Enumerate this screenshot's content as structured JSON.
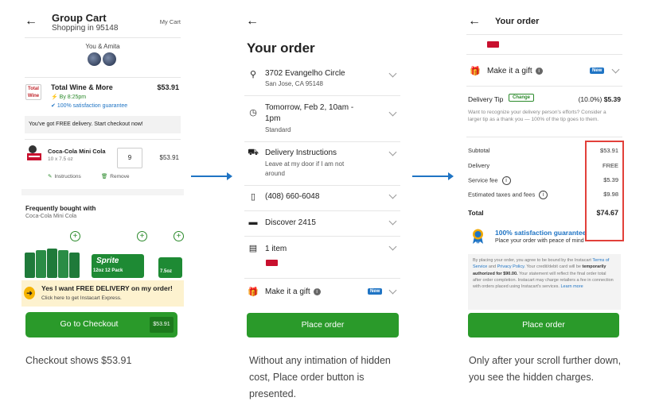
{
  "panel1": {
    "title": "Group Cart",
    "subtitle": "Shopping in 95148",
    "my_cart": "My Cart",
    "members": "You & Amita",
    "store": {
      "logo_text": "Total Wine",
      "name": "Total Wine & More",
      "price": "$53.91",
      "eta": "By 8:25pm",
      "guarantee": "100% satisfaction guarantee"
    },
    "free_delivery_notice": "You've got FREE delivery. Start checkout now!",
    "item": {
      "name": "Coca-Cola Mini Cola",
      "size": "10 x 7.5 oz",
      "quantity": "9",
      "price": "$53.91",
      "instructions_label": "Instructions",
      "remove_label": "Remove"
    },
    "frequently_bought": {
      "title": "Frequently bought with",
      "subtitle": "Coca-Cola Mini Cola",
      "pack_label_1": "12oz 12 Pack",
      "pack_label_2": "7.5oz"
    },
    "promo": {
      "title": "Yes I want FREE DELIVERY on my order!",
      "subtitle": "Click here to get Instacart Express."
    },
    "checkout_button": "Go to Checkout",
    "checkout_price": "$53.91"
  },
  "panel2": {
    "title": "Your order",
    "address": {
      "line1": "3702 Evangelho Circle",
      "line2": "San Jose, CA 95148"
    },
    "delivery_time": {
      "line1": "Tomorrow, Feb 2, 10am -",
      "line2": "1pm",
      "sub": "Standard"
    },
    "instructions": {
      "title": "Delivery Instructions",
      "line1": "Leave at my door if I am not",
      "line2": "around"
    },
    "phone": "(408) 660-6048",
    "payment": "Discover 2415",
    "items": "1 item",
    "gift": "Make it a gift",
    "new_badge": "New",
    "place_order": "Place order"
  },
  "panel3": {
    "title": "Your order",
    "gift": "Make it a gift",
    "new_badge": "New",
    "tip": {
      "label": "Delivery Tip",
      "change": "Change",
      "percent": "(10.0%)",
      "amount": "$5.39",
      "description": "Want to recognize your delivery person's efforts? Consider a larger tip as a thank you — 100% of the tip goes to them."
    },
    "summary": {
      "subtotal_label": "Subtotal",
      "subtotal": "$53.91",
      "delivery_label": "Delivery",
      "delivery": "FREE",
      "service_label": "Service fee",
      "service": "$5.39",
      "taxes_label": "Estimated taxes and fees",
      "taxes": "$9.98",
      "total_label": "Total",
      "total": "$74.67"
    },
    "guarantee_title": "100% satisfaction guarantee",
    "guarantee_sub": "Place your order with peace of mind",
    "legal": {
      "p1": "By placing your order, you agree to be bound by the Instacart",
      "terms": "Terms of Service",
      "and": "and",
      "privacy": "Privacy Policy.",
      "p2": "Your credit/debit card will be",
      "auth": "temporarily authorized for $90.00.",
      "p3": "Your statement will reflect the final order total after order completion.",
      "p4": "Instacart may charge retailers a fee in connection with orders placed using Instacart's services.",
      "learn": "Learn more"
    },
    "place_order": "Place order"
  },
  "captions": {
    "c1": "Checkout shows $53.91",
    "c2": "Without any intimation of hidden cost, Place order button is presented.",
    "c3": "Only after your scroll further down, you see the hidden charges."
  }
}
